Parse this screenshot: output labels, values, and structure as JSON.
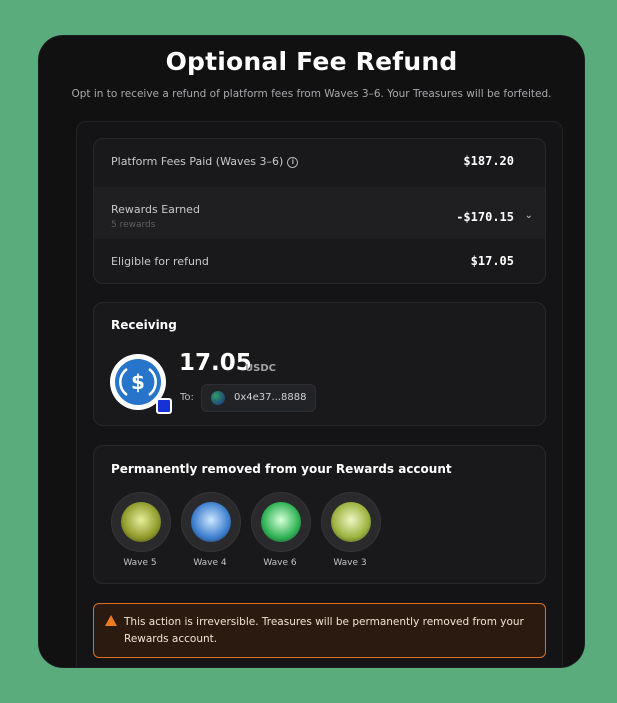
{
  "modal": {
    "title": "Optional Fee Refund",
    "subtitle": "Opt in to receive a refund of platform fees from Waves 3–6. Your Treasures will be forfeited."
  },
  "fees": {
    "platform_fees_label": "Platform Fees Paid (Waves 3–6)",
    "platform_fees_value": "$187.20",
    "rewards_label": "Rewards Earned",
    "rewards_sub": "5 rewards",
    "rewards_value": "-$170.15",
    "eligible_label": "Eligible for refund",
    "eligible_value": "$17.05"
  },
  "receiving": {
    "title": "Receiving",
    "amount": "17.05",
    "unit": "USDC",
    "to_label": "To:",
    "address": "0x4e37...8888"
  },
  "removed": {
    "title": "Permanently removed from your Rewards account",
    "badges": [
      {
        "label": "Wave 5",
        "color": "#b8c24a"
      },
      {
        "label": "Wave 4",
        "color": "#4f8fd6"
      },
      {
        "label": "Wave 6",
        "color": "#2fb254"
      },
      {
        "label": "Wave 3",
        "color": "#a8c24a"
      }
    ]
  },
  "warning": {
    "text": "This action is irreversible. Treasures will be permanently removed from your Rewards account."
  },
  "colors": {
    "background": "#5aac7c",
    "modal": "#111112",
    "warning_border": "#d86f21",
    "usdc_blue": "#2775ca"
  }
}
